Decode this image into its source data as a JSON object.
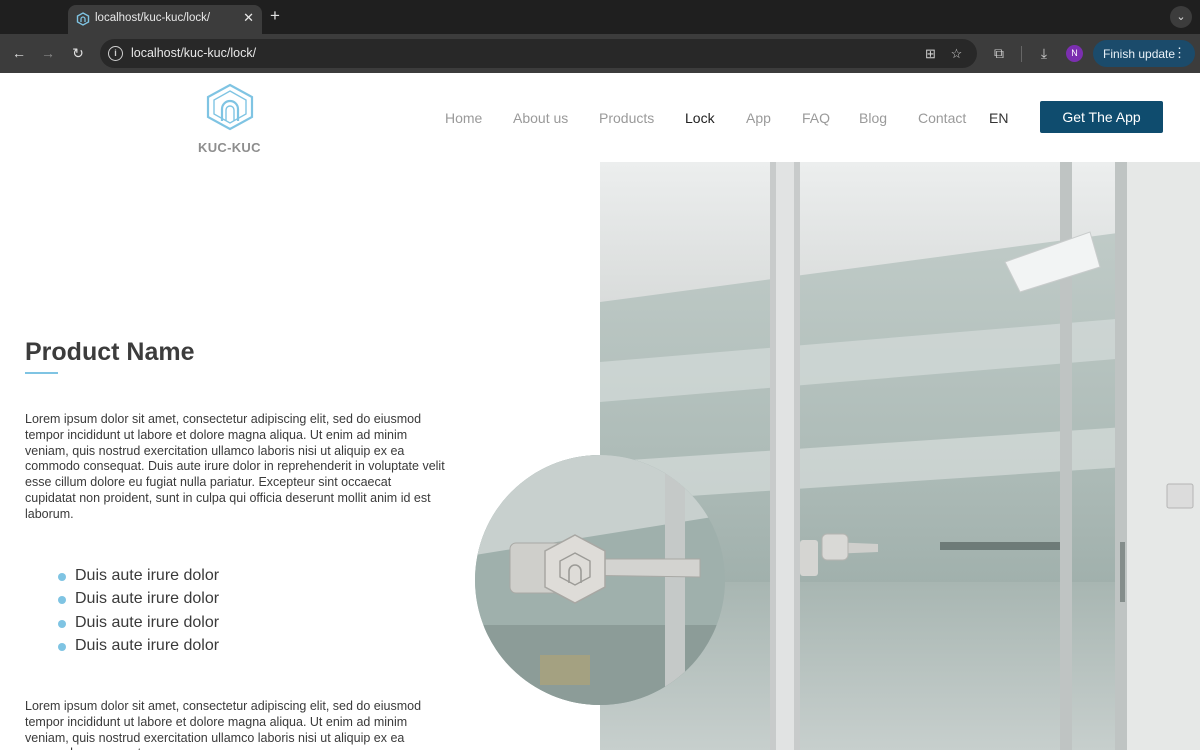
{
  "browser": {
    "tab_title": "localhost/kuc-kuc/lock/",
    "url": "localhost/kuc-kuc/lock/",
    "profile_initial": "N",
    "finish_update_label": "Finish update"
  },
  "site": {
    "logo_text": "KUC-KUC",
    "nav": [
      {
        "label": "Home"
      },
      {
        "label": "About us"
      },
      {
        "label": "Products"
      },
      {
        "label": "Lock"
      },
      {
        "label": "App"
      },
      {
        "label": "FAQ"
      },
      {
        "label": "Blog"
      },
      {
        "label": "Contact"
      }
    ],
    "active_nav": "Lock",
    "language": "EN",
    "cta_label": "Get The App"
  },
  "content": {
    "title": "Product Name",
    "paragraph1": "Lorem ipsum dolor sit amet, consectetur adipiscing elit, sed do eiusmod tempor incididunt ut labore et dolore magna aliqua. Ut enim ad minim veniam, quis nostrud exercitation ullamco laboris nisi ut aliquip ex ea commodo consequat. Duis aute irure dolor in reprehenderit in voluptate velit esse cillum dolore eu fugiat nulla pariatur. Excepteur sint occaecat cupidatat non proident, sunt in culpa qui officia deserunt mollit anim id est laborum.",
    "bullets": [
      "Duis aute irure dolor",
      "Duis aute irure dolor",
      "Duis aute irure dolor",
      "Duis aute irure dolor"
    ],
    "paragraph2": "Lorem ipsum dolor sit amet, consectetur adipiscing elit, sed do eiusmod tempor incididunt ut labore et dolore magna aliqua. Ut enim ad minim veniam, quis nostrud exercitation ullamco laboris nisi ut aliquip ex ea commodo consequat."
  },
  "colors": {
    "accent": "#7fc4e3",
    "cta": "#0f4c6e",
    "update_button": "#1b4b6b"
  }
}
